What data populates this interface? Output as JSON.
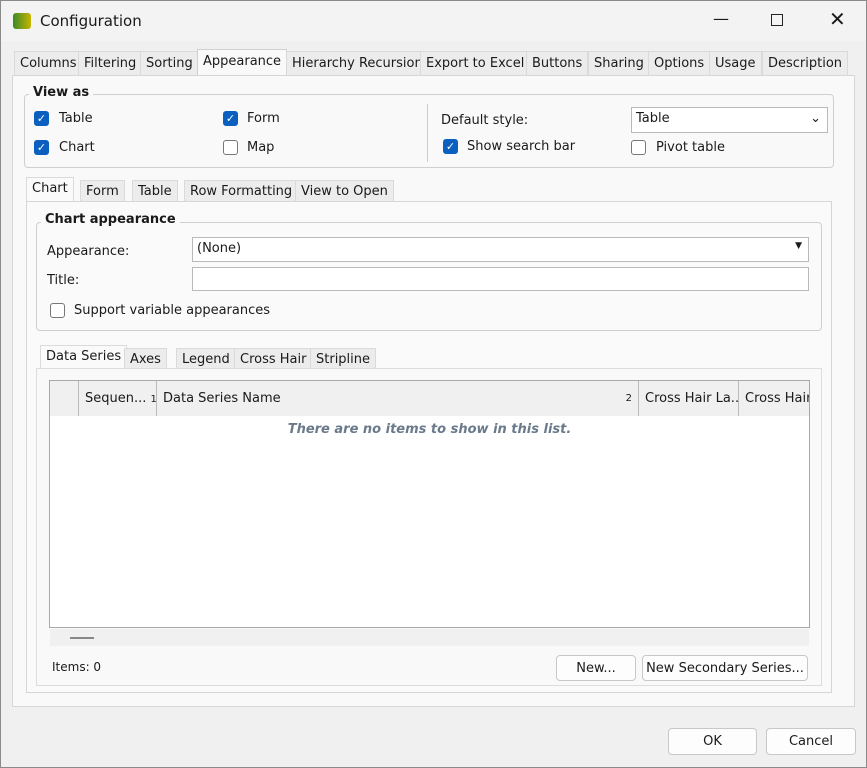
{
  "window": {
    "title": "Configuration"
  },
  "main_tabs": [
    "Columns",
    "Filtering",
    "Sorting",
    "Appearance",
    "Hierarchy Recursion",
    "Export to Excel",
    "Buttons",
    "Sharing",
    "Options",
    "Usage",
    "Description"
  ],
  "view_as": {
    "label": "View as",
    "table": "Table",
    "form": "Form",
    "chart": "Chart",
    "map": "Map",
    "default_style_label": "Default style:",
    "default_style_value": "Table",
    "show_search_bar": "Show search bar",
    "pivot_table": "Pivot table"
  },
  "sub_tabs": [
    "Chart",
    "Form",
    "Table",
    "Row Formatting",
    "View to Open"
  ],
  "chart_appearance": {
    "label": "Chart appearance",
    "appearance_label": "Appearance:",
    "appearance_value": "(None)",
    "title_label": "Title:",
    "title_value": "",
    "support_variable": "Support variable appearances"
  },
  "series_tabs": [
    "Data Series",
    "Axes",
    "Legend",
    "Cross Hair",
    "Stripline"
  ],
  "grid": {
    "columns": [
      "Sequen...",
      "Data Series Name",
      "Cross Hair La...",
      "Cross Hair"
    ],
    "sort1": "1",
    "sort2": "2",
    "empty": "There are no items to show in this list."
  },
  "items_label": "Items: 0",
  "buttons": {
    "new": "New...",
    "new_secondary": "New Secondary Series...",
    "ok": "OK",
    "cancel": "Cancel"
  }
}
